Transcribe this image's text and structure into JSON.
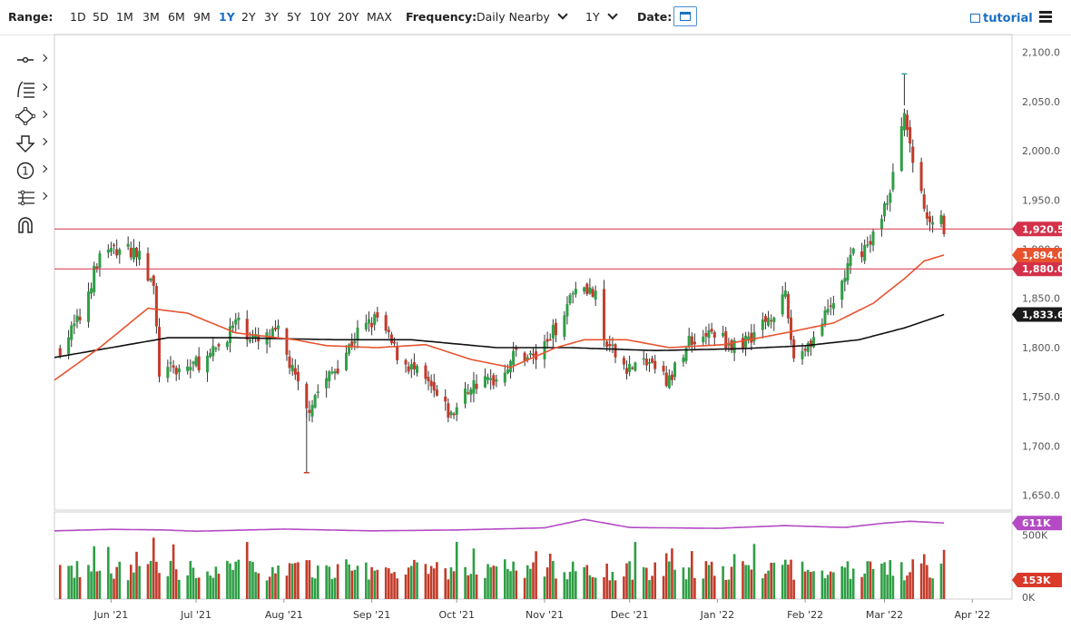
{
  "toolbar": {
    "range_label": "Range:",
    "ranges": [
      "1D",
      "5D",
      "1M",
      "3M",
      "6M",
      "9M",
      "1Y",
      "2Y",
      "3Y",
      "5Y",
      "10Y",
      "20Y",
      "MAX"
    ],
    "active_range": "1Y",
    "frequency_label": "Frequency:",
    "frequency_value": "Daily Nearby",
    "period_value": "1Y",
    "date_label": "Date:",
    "tutorial_label": "tutorial"
  },
  "left_tools": [
    "crosshair-icon",
    "fib-icon",
    "shape-icon",
    "arrow-icon",
    "counter-icon",
    "pitchfork-icon",
    "magnet-icon"
  ],
  "counter_glyph": "1",
  "colors": {
    "up": "#2e9e45",
    "down": "#c23b2a",
    "ma_short": "#e8532f",
    "ma_long": "#111111",
    "hline": "#d4304a",
    "open_interest": "#b44bc4"
  },
  "chart_data": {
    "type": "candlestick",
    "price_axis": {
      "ticks": [
        2100.0,
        2050.0,
        2000.0,
        1950.0,
        1900.0,
        1850.0,
        1800.0,
        1750.0,
        1700.0,
        1650.0
      ],
      "labels": [
        "2,100.0",
        "2,050.0",
        "2,000.0",
        "1,950.0",
        "1,900.0",
        "1,850.0",
        "1,800.0",
        "1,750.0",
        "1,700.0",
        "1,650.0"
      ],
      "range": [
        1635,
        2118
      ]
    },
    "volume_axis": {
      "ticks": [
        500000,
        0
      ],
      "labels": [
        "500K",
        "0K"
      ],
      "range": [
        0,
        700000
      ]
    },
    "x_axis": {
      "labels": [
        "Jun '21",
        "Jul '21",
        "Aug '21",
        "Sep '21",
        "Oct '21",
        "Nov '21",
        "Dec '21",
        "Jan '22",
        "Feb '22",
        "Mar '22",
        "Apr '22"
      ],
      "start": "2021-05-12",
      "end": "2022-04-15"
    },
    "horizontal_lines": [
      {
        "value": 1920.5,
        "label": "1,920.5"
      },
      {
        "value": 1880.0,
        "label": "1,880.0"
      }
    ],
    "current_markers": [
      {
        "value": 1894.0,
        "label": "1,894.0",
        "series": "ma_short"
      },
      {
        "value": 1833.6,
        "label": "1,833.6",
        "series": "ma_long"
      }
    ],
    "volume_markers": [
      {
        "value": 611000,
        "label": "611K",
        "series": "open_interest"
      },
      {
        "value": 153000,
        "label": "153K",
        "series": "volume"
      }
    ],
    "price_anchors": [
      [
        "2021-05-14",
        1800
      ],
      [
        "2021-05-21",
        1830
      ],
      [
        "2021-05-28",
        1895
      ],
      [
        "2021-06-04",
        1900
      ],
      [
        "2021-06-10",
        1898
      ],
      [
        "2021-06-16",
        1860
      ],
      [
        "2021-06-18",
        1775
      ],
      [
        "2021-06-28",
        1780
      ],
      [
        "2021-07-06",
        1790
      ],
      [
        "2021-07-15",
        1825
      ],
      [
        "2021-07-23",
        1805
      ],
      [
        "2021-07-30",
        1815
      ],
      [
        "2021-08-06",
        1760
      ],
      [
        "2021-08-09",
        1735
      ],
      [
        "2021-08-12",
        1752
      ],
      [
        "2021-08-20",
        1782
      ],
      [
        "2021-08-27",
        1815
      ],
      [
        "2021-09-03",
        1830
      ],
      [
        "2021-09-10",
        1793
      ],
      [
        "2021-09-20",
        1765
      ],
      [
        "2021-09-29",
        1730
      ],
      [
        "2021-10-06",
        1762
      ],
      [
        "2021-10-15",
        1768
      ],
      [
        "2021-10-22",
        1795
      ],
      [
        "2021-10-29",
        1790
      ],
      [
        "2021-11-05",
        1820
      ],
      [
        "2021-11-12",
        1865
      ],
      [
        "2021-11-16",
        1862
      ],
      [
        "2021-11-19",
        1850
      ],
      [
        "2021-11-22",
        1805
      ],
      [
        "2021-11-30",
        1780
      ],
      [
        "2021-12-08",
        1785
      ],
      [
        "2021-12-15",
        1765
      ],
      [
        "2021-12-22",
        1808
      ],
      [
        "2021-12-31",
        1815
      ],
      [
        "2022-01-07",
        1800
      ],
      [
        "2022-01-14",
        1815
      ],
      [
        "2022-01-25",
        1850
      ],
      [
        "2022-01-28",
        1790
      ],
      [
        "2022-02-04",
        1810
      ],
      [
        "2022-02-11",
        1845
      ],
      [
        "2022-02-18",
        1895
      ],
      [
        "2022-02-24",
        1905
      ],
      [
        "2022-03-01",
        1945
      ],
      [
        "2022-03-03",
        1955
      ],
      [
        "2022-03-08",
        2045
      ],
      [
        "2022-03-10",
        2000
      ],
      [
        "2022-03-14",
        1960
      ],
      [
        "2022-03-16",
        1925
      ],
      [
        "2022-03-18",
        1935
      ],
      [
        "2022-03-21",
        1935
      ],
      [
        "2022-03-22",
        1918
      ]
    ],
    "series": [
      {
        "key": "ma_short",
        "anchors": [
          [
            "2021-05-12",
            1767
          ],
          [
            "2021-05-28",
            1800
          ],
          [
            "2021-06-14",
            1840
          ],
          [
            "2021-06-28",
            1835
          ],
          [
            "2021-07-15",
            1815
          ],
          [
            "2021-08-05",
            1808
          ],
          [
            "2021-08-16",
            1802
          ],
          [
            "2021-09-03",
            1800
          ],
          [
            "2021-09-20",
            1803
          ],
          [
            "2021-10-06",
            1788
          ],
          [
            "2021-10-20",
            1780
          ],
          [
            "2021-11-05",
            1800
          ],
          [
            "2021-11-15",
            1808
          ],
          [
            "2021-11-30",
            1808
          ],
          [
            "2021-12-15",
            1800
          ],
          [
            "2022-01-03",
            1803
          ],
          [
            "2022-01-25",
            1815
          ],
          [
            "2022-02-11",
            1825
          ],
          [
            "2022-02-25",
            1845
          ],
          [
            "2022-03-08",
            1870
          ],
          [
            "2022-03-15",
            1888
          ],
          [
            "2022-03-22",
            1894
          ]
        ]
      },
      {
        "key": "ma_long",
        "anchors": [
          [
            "2021-05-12",
            1790
          ],
          [
            "2021-06-01",
            1800
          ],
          [
            "2021-06-21",
            1810
          ],
          [
            "2021-07-15",
            1810
          ],
          [
            "2021-08-20",
            1808
          ],
          [
            "2021-09-15",
            1808
          ],
          [
            "2021-10-15",
            1800
          ],
          [
            "2021-11-10",
            1800
          ],
          [
            "2021-12-10",
            1797
          ],
          [
            "2022-01-10",
            1799
          ],
          [
            "2022-02-01",
            1802
          ],
          [
            "2022-02-20",
            1808
          ],
          [
            "2022-03-08",
            1820
          ],
          [
            "2022-03-22",
            1833.6
          ]
        ]
      },
      {
        "key": "open_interest",
        "anchors": [
          [
            "2021-05-12",
            548000
          ],
          [
            "2021-06-01",
            560000
          ],
          [
            "2021-06-20",
            555000
          ],
          [
            "2021-07-01",
            545000
          ],
          [
            "2021-08-01",
            562000
          ],
          [
            "2021-09-01",
            548000
          ],
          [
            "2021-10-01",
            555000
          ],
          [
            "2021-11-01",
            572000
          ],
          [
            "2021-11-15",
            640000
          ],
          [
            "2021-12-01",
            575000
          ],
          [
            "2022-01-01",
            568000
          ],
          [
            "2022-01-25",
            590000
          ],
          [
            "2022-02-15",
            575000
          ],
          [
            "2022-03-01",
            610000
          ],
          [
            "2022-03-10",
            625000
          ],
          [
            "2022-03-22",
            611000
          ]
        ]
      }
    ]
  }
}
